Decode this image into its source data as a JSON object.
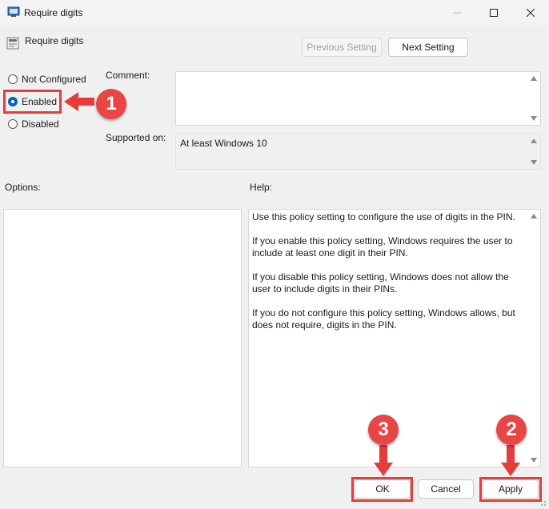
{
  "window": {
    "title": "Require digits",
    "icons": {
      "app": "policy-app-icon",
      "minimize": "minimize-icon",
      "maximize": "maximize-icon",
      "close": "close-icon"
    }
  },
  "header": {
    "policy_name": "Require digits",
    "previous_setting": "Previous Setting",
    "next_setting": "Next Setting"
  },
  "state": {
    "options": [
      {
        "label": "Not Configured",
        "checked": false
      },
      {
        "label": "Enabled",
        "checked": true
      },
      {
        "label": "Disabled",
        "checked": false
      }
    ]
  },
  "comment": {
    "label": "Comment:",
    "value": ""
  },
  "supported": {
    "label": "Supported on:",
    "value": "At least Windows 10"
  },
  "options_panel": {
    "label": "Options:"
  },
  "help": {
    "label": "Help:",
    "paragraphs": [
      "Use this policy setting to configure the use of digits in the PIN.",
      "If you enable this policy setting, Windows requires the user to include at least one digit in their PIN.",
      "If you disable this policy setting, Windows does not allow the user to include digits in their PINs.",
      "If you do not configure this policy setting, Windows allows, but does not require, digits in the PIN."
    ]
  },
  "footer": {
    "ok": "OK",
    "cancel": "Cancel",
    "apply": "Apply"
  },
  "annotations": {
    "step1": "1",
    "step2": "2",
    "step3": "3",
    "color": "#e53c3c"
  },
  "colors": {
    "accent": "#0067c0",
    "annotation": "#e53c3c"
  }
}
